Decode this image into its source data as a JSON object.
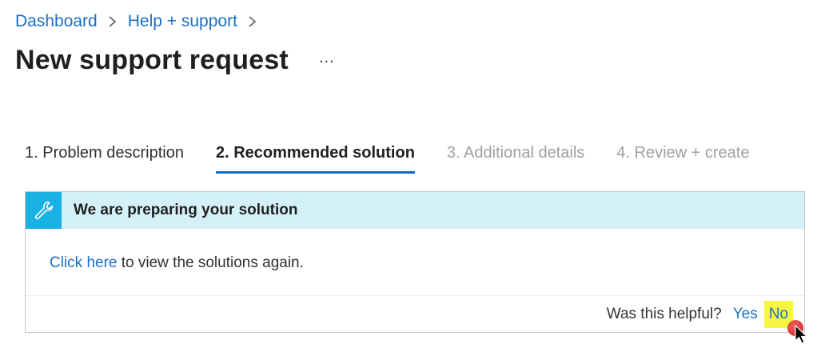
{
  "breadcrumb": {
    "items": [
      {
        "label": "Dashboard"
      },
      {
        "label": "Help + support"
      }
    ]
  },
  "header": {
    "title": "New support request",
    "more_label": "..."
  },
  "tabs": [
    {
      "label": "1. Problem description",
      "state": "done"
    },
    {
      "label": "2. Recommended solution",
      "state": "active"
    },
    {
      "label": "3. Additional details",
      "state": "disabled"
    },
    {
      "label": "4. Review + create",
      "state": "disabled"
    }
  ],
  "panel": {
    "icon": "wrench-icon",
    "title": "We are preparing your solution",
    "link_text": "Click here",
    "body_rest": " to view the solutions again.",
    "helpful_question": "Was this helpful?",
    "yes_label": "Yes",
    "no_label": "No"
  },
  "colors": {
    "link": "#1a6fc4",
    "accent": "#0f6cbd",
    "banner_bg": "#d4f0f8",
    "icon_bg": "#19b0e3",
    "highlight": "#f5f542"
  }
}
